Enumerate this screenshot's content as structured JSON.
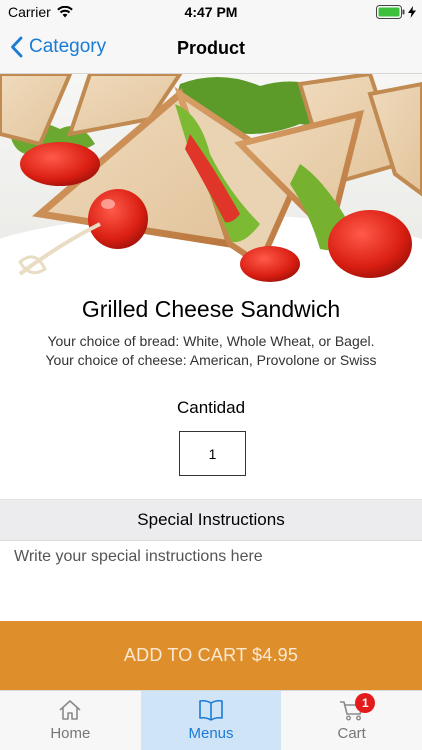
{
  "status_bar": {
    "carrier": "Carrier",
    "time": "4:47 PM"
  },
  "nav": {
    "back_label": "Category",
    "title": "Product"
  },
  "product": {
    "name": "Grilled Cheese Sandwich",
    "description_lines": [
      "Your choice of bread: White, Whole Wheat, or Bagel.",
      "Your choice of cheese: American, Provolone or Swiss"
    ],
    "quantity_label": "Cantidad",
    "quantity_value": "1"
  },
  "special_instructions": {
    "header": "Special Instructions",
    "placeholder": "Write your special instructions here"
  },
  "add_to_cart": {
    "label": "ADD TO CART $4.95"
  },
  "tab_bar": {
    "tabs": [
      {
        "label": "Home",
        "icon": "home-icon",
        "active": false
      },
      {
        "label": "Menus",
        "icon": "book-icon",
        "active": true
      },
      {
        "label": "Cart",
        "icon": "cart-icon",
        "active": false,
        "badge": "1"
      }
    ]
  },
  "colors": {
    "accent": "#1a7bd6",
    "button": "#de8f2c",
    "badge": "#e31b1b",
    "active_tab_bg": "#cfe4f7"
  }
}
